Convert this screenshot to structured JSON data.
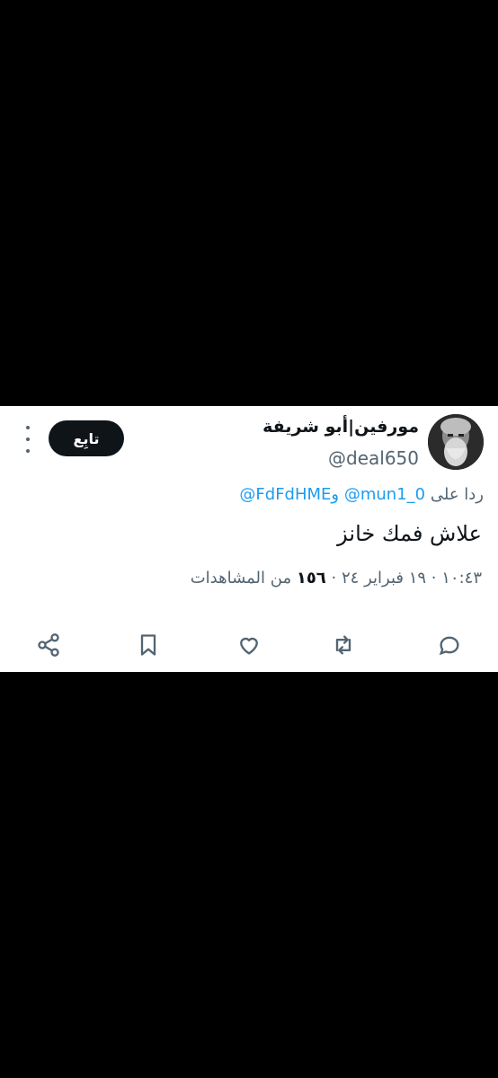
{
  "tweet": {
    "display_name": "مورفين|أبو شريفة",
    "handle": "@deal650",
    "follow_label": "تابِع",
    "reply_prefix": "ردا على",
    "reply_mention_1": "@mun1_0",
    "reply_conjunction": "و",
    "reply_mention_2": "@FdFdHME",
    "text": "علاش فمك خانز",
    "time": "١٠:٤٣",
    "date": "١٩ فبراير ٢٤",
    "views_count": "١٥٦",
    "views_label": "من المشاهدات",
    "separator": "·"
  },
  "icons": {
    "avatar": "avatar-image",
    "more": "more-vertical-icon",
    "reply": "reply-icon",
    "retweet": "retweet-icon",
    "like": "heart-icon",
    "bookmark": "bookmark-icon",
    "share": "share-icon"
  },
  "colors": {
    "background": "#000000",
    "card": "#ffffff",
    "text": "#0f1419",
    "secondary": "#536471",
    "link": "#1d9bf0"
  }
}
